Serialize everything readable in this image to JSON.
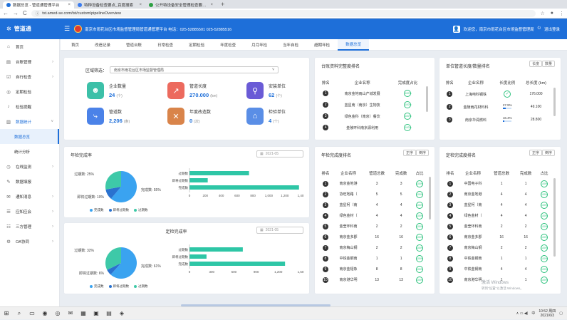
{
  "browser": {
    "tabs": [
      {
        "title": "数据总览 - 管道通管理平台",
        "active": true,
        "color": "#1e6fd9"
      },
      {
        "title": "特种设备检查要点_百度搜索",
        "active": false,
        "color": "#3a7cf0"
      },
      {
        "title": "公开特设备安全管理检查要点 ·",
        "active": false,
        "color": "#2ea043"
      }
    ],
    "new_tab": "+",
    "url": "tst.amed-se.com/tst/custom/pipelineOverview",
    "nav": {
      "back": "←",
      "forward": "→",
      "reload": "C"
    }
  },
  "app": {
    "brand": "管道通",
    "notice": "南京市雨花台区市场监督管理局管道通管理平台 电话：025-52885501 025-52885516",
    "user": {
      "greeting": "欢迎您，南京市雨花台区市场监督管理局",
      "logout": "退出登录"
    }
  },
  "sidebar": {
    "items": [
      {
        "label": "首页",
        "icon": "home-icon",
        "glyph": "⌂"
      },
      {
        "label": "台账管理",
        "icon": "ledger-icon",
        "glyph": "▤",
        "chevron": "›"
      },
      {
        "label": "自行检查",
        "icon": "check-icon",
        "glyph": "☑",
        "chevron": "›"
      },
      {
        "label": "定期检验",
        "icon": "inspect-icon",
        "glyph": "◎"
      },
      {
        "label": "检验提醒",
        "icon": "bell-icon",
        "glyph": "♪"
      },
      {
        "label": "数据统计",
        "icon": "stats-icon",
        "glyph": "▥",
        "chevron": "˅",
        "open": true
      },
      {
        "label": "数据总览",
        "sub": true,
        "selected": true
      },
      {
        "label": "统计分析",
        "sub": true
      },
      {
        "label": "在线监测",
        "icon": "monitor-icon",
        "glyph": "◷",
        "chevron": "›"
      },
      {
        "label": "数据填报",
        "icon": "report-icon",
        "glyph": "✎"
      },
      {
        "label": "通知消息",
        "icon": "message-icon",
        "glyph": "✉",
        "chevron": "›"
      },
      {
        "label": "应知应会",
        "icon": "book-icon",
        "glyph": "☰",
        "chevron": "›"
      },
      {
        "label": "三方管理",
        "icon": "group-icon",
        "glyph": "☷",
        "chevron": "›"
      },
      {
        "label": "OA协同",
        "icon": "oa-icon",
        "glyph": "⚙",
        "chevron": "›"
      }
    ]
  },
  "nav_tabs": [
    "首页",
    "改造记录",
    "管道台账",
    "日常检查",
    "定期检验",
    "年度检查",
    "月月年检",
    "当年自检",
    "超期年检",
    "数据总览"
  ],
  "active_nav_tab": 9,
  "filter": {
    "label": "区域筛选：",
    "value": "南京市雨花台区市场监督管理局"
  },
  "stats": [
    {
      "label": "企业数量",
      "value": "24",
      "unit": "(个)",
      "color": "#3cc0a8",
      "glyph": "☻",
      "icon": "enterprise-icon"
    },
    {
      "label": "管道长度",
      "value": "270.000",
      "unit": "(km)",
      "color": "#ec6a5e",
      "glyph": "↗",
      "icon": "pipeline-length-icon"
    },
    {
      "label": "安装单位",
      "value": "62",
      "unit": "(个)",
      "color": "#6a5bd6",
      "glyph": "⚲",
      "icon": "installer-icon"
    },
    {
      "label": "管道数",
      "value": "2,206",
      "unit": "(条)",
      "color": "#4b82e8",
      "glyph": "⤷",
      "icon": "pipe-count-icon"
    },
    {
      "label": "年度改造数",
      "value": "0",
      "unit": "(次)",
      "color": "#d9844a",
      "glyph": "✕",
      "icon": "renovation-icon"
    },
    {
      "label": "检验单位",
      "value": "4",
      "unit": "(个)",
      "color": "#5a8ee6",
      "glyph": "⌂",
      "icon": "inspection-unit-icon"
    }
  ],
  "annual_check": {
    "title": "年检完成率",
    "date": "2021-05",
    "pie_labels": [
      {
        "text": "过期数: 25%",
        "pos": "upper-left"
      },
      {
        "text": "即将过期数: 10%",
        "pos": "left"
      },
      {
        "text": "完成数: 55%",
        "pos": "right"
      }
    ],
    "legend": [
      "完成数",
      "即将过期数",
      "过期数"
    ]
  },
  "periodic_check": {
    "title": "定检完成率",
    "date": "2021-05",
    "pie_labels": [
      {
        "text": "过期数: 32%",
        "pos": "upper-left"
      },
      {
        "text": "即将过期数: 6%",
        "pos": "left"
      },
      {
        "text": "完成数: 61%",
        "pos": "right"
      }
    ],
    "legend": [
      "完成数",
      "即将过期数",
      "过期数"
    ]
  },
  "chart_data": [
    {
      "type": "pie",
      "title": "年检完成率",
      "labels": [
        "完成数",
        "即将过期数",
        "过期数"
      ],
      "values": [
        55,
        10,
        25
      ],
      "colors": [
        "#3aa3f0",
        "#2a72cf",
        "#3ec9a8"
      ]
    },
    {
      "type": "bar",
      "orientation": "horizontal",
      "categories": [
        "过期数",
        "即将过期数",
        "完成数"
      ],
      "values": [
        750,
        230,
        1380
      ],
      "xlim": [
        0,
        1400
      ],
      "ticks": [
        "0",
        "200",
        "400",
        "600",
        "800",
        "1,000",
        "1,200",
        "1,40"
      ],
      "color": "#2ec6a6"
    },
    {
      "type": "pie",
      "title": "定检完成率",
      "labels": [
        "完成数",
        "即将过期数",
        "过期数"
      ],
      "values": [
        61,
        6,
        32
      ],
      "colors": [
        "#3aa3f0",
        "#2a72cf",
        "#3ec9a8"
      ]
    },
    {
      "type": "bar",
      "orientation": "horizontal",
      "categories": [
        "过期数",
        "即将过期数",
        "完成数"
      ],
      "values": [
        720,
        230,
        1290
      ],
      "xlim": [
        0,
        1500
      ],
      "ticks": [
        "0",
        "300",
        "600",
        "900",
        "1,200",
        "1,50"
      ],
      "color": "#2ec6a6"
    }
  ],
  "ledger_rank": {
    "title": "台账资料完整度排名",
    "headers": [
      "排名",
      "企业名称",
      "完成度占比"
    ],
    "rows": [
      {
        "rank": "1",
        "name": "南京金地雨山产城发展",
        "pct": "100%",
        "fill": 1.0
      },
      {
        "rank": "2",
        "name": "蓝星南（南京）生物技",
        "pct": "100%",
        "fill": 1.0
      },
      {
        "rank": "3",
        "name": "绿色金科（南京）餐饮",
        "pct": "100%",
        "fill": 1.0
      },
      {
        "rank": "4",
        "name": "金陵环科南京源利用",
        "pct": "100%",
        "fill": 1.0
      }
    ]
  },
  "length_rank": {
    "title": "单位管道长度/数量排名",
    "btns": [
      "长度",
      "数量"
    ],
    "headers": [
      "排名",
      "企业名称",
      "长度比例",
      "总长度\n(km)"
    ],
    "rows": [
      {
        "rank": "1",
        "name": "上海电科钢铁",
        "ratio": "✓",
        "total": "176.000"
      },
      {
        "rank": "2",
        "name": "金陵雨花材料科",
        "ratio": "27.9%",
        "total": "49.100",
        "fill": 0.28
      },
      {
        "rank": "3",
        "name": "南京华润燃料",
        "ratio": "16.4%",
        "total": "28.800",
        "fill": 0.16
      }
    ]
  },
  "annual_rank": {
    "title": "年检完成度排名",
    "btns": [
      "正序",
      "倒序"
    ],
    "headers": [
      "排名",
      "企业名称",
      "管道总数",
      "完成数",
      "占比"
    ],
    "rows": [
      {
        "rank": "1",
        "name": "南京金地港",
        "total": "3",
        "done": "3",
        "pct": "100%"
      },
      {
        "rank": "2",
        "name": "协旺地路（",
        "total": "5",
        "done": "5",
        "pct": "100%"
      },
      {
        "rank": "3",
        "name": "蓝星柯（南",
        "total": "4",
        "done": "4",
        "pct": "100%"
      },
      {
        "rank": "4",
        "name": "绿色金材（",
        "total": "4",
        "done": "4",
        "pct": "100%"
      },
      {
        "rank": "5",
        "name": "金莹环科南",
        "total": "2",
        "done": "2",
        "pct": "100%"
      },
      {
        "rank": "6",
        "name": "南京金多郡",
        "total": "16",
        "done": "16",
        "pct": "100%"
      },
      {
        "rank": "7",
        "name": "南京梅山钢",
        "total": "2",
        "done": "2",
        "pct": "100%"
      },
      {
        "rank": "8",
        "name": "中铁金钢南",
        "total": "1",
        "done": "1",
        "pct": "100%"
      },
      {
        "rank": "9",
        "name": "南京金翅象",
        "total": "8",
        "done": "8",
        "pct": "100%"
      },
      {
        "rank": "10",
        "name": "南京港华明",
        "total": "13",
        "done": "13",
        "pct": "100%"
      }
    ]
  },
  "periodic_rank": {
    "title": "定检完成度排名",
    "btns": [
      "正序",
      "倒序"
    ],
    "headers": [
      "排名",
      "企业名称",
      "管道总数",
      "完成数",
      "占比"
    ],
    "rows": [
      {
        "rank": "1",
        "name": "中国电子科",
        "total": "1",
        "done": "1",
        "pct": "100%"
      },
      {
        "rank": "2",
        "name": "南京金地港",
        "total": "4",
        "done": "4",
        "pct": "100%"
      },
      {
        "rank": "3",
        "name": "蓝星柯（南",
        "total": "4",
        "done": "4",
        "pct": "100%"
      },
      {
        "rank": "4",
        "name": "绿色金材（",
        "total": "4",
        "done": "4",
        "pct": "100%"
      },
      {
        "rank": "5",
        "name": "金莹环科南",
        "total": "2",
        "done": "2",
        "pct": "100%"
      },
      {
        "rank": "6",
        "name": "南京金多郡",
        "total": "16",
        "done": "16",
        "pct": "100%"
      },
      {
        "rank": "7",
        "name": "南京梅山钢",
        "total": "2",
        "done": "2",
        "pct": "100%"
      },
      {
        "rank": "8",
        "name": "中铁金钢南",
        "total": "1",
        "done": "1",
        "pct": "100%"
      },
      {
        "rank": "9",
        "name": "中铁金钢南",
        "total": "4",
        "done": "4",
        "pct": "100%"
      },
      {
        "rank": "10",
        "name": "南京港华明",
        "total": "1",
        "done": "1",
        "pct": "100%"
      }
    ]
  },
  "watermark": {
    "line1": "激活 Windows",
    "line2": "转到\"设置\"以激活 Windows。"
  },
  "taskbar": {
    "apps": [
      "⊞",
      "⌕",
      "▭",
      "◉",
      "◎",
      "✉",
      "▦",
      "▣",
      "▤",
      "◈"
    ],
    "tray": {
      "lang": "中",
      "time": "10:52 周四",
      "date": "2021/6/3"
    }
  }
}
